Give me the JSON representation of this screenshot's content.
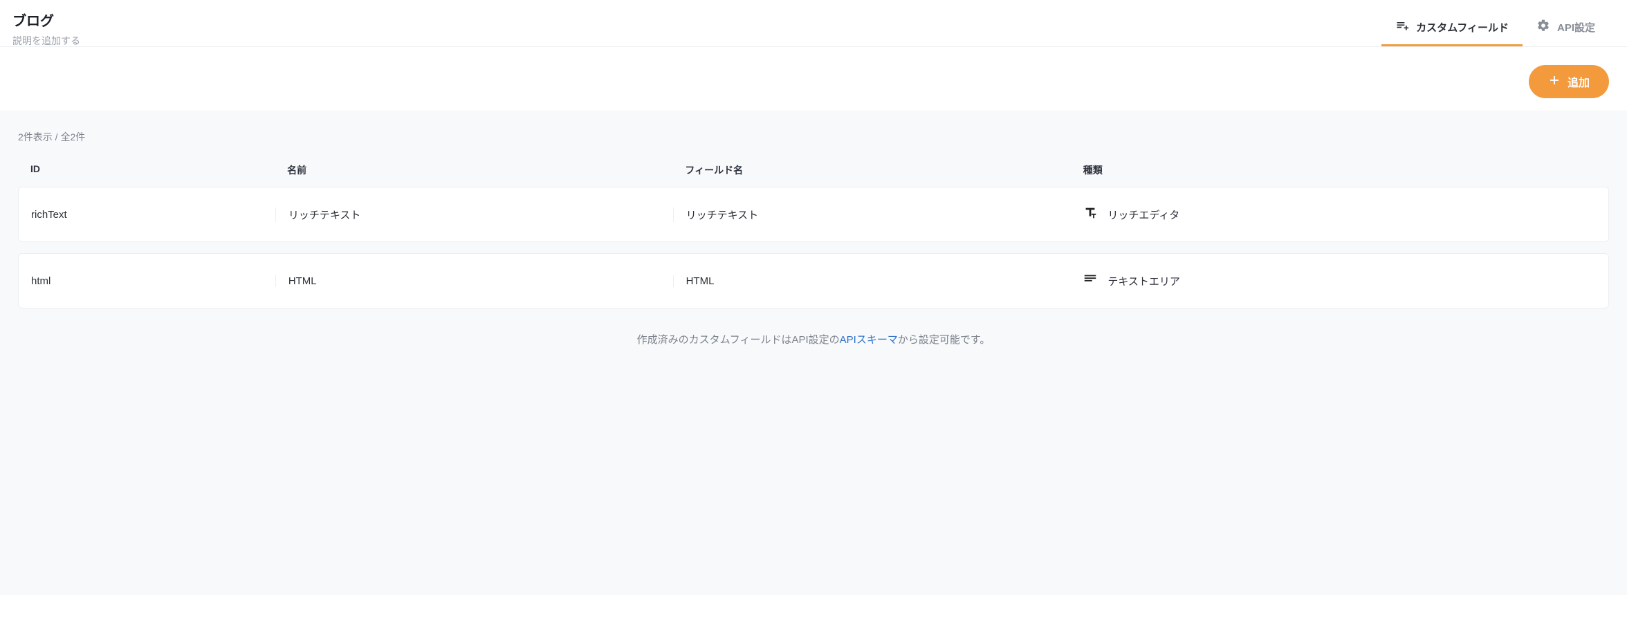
{
  "header": {
    "title": "ブログ",
    "subtitle": "説明を追加する",
    "tabs": {
      "custom_field": "カスタムフィールド",
      "api_settings": "API設定"
    }
  },
  "action": {
    "add": "追加"
  },
  "list": {
    "count": "2件表示 / 全2件",
    "columns": {
      "id": "ID",
      "name": "名前",
      "field_name": "フィールド名",
      "type": "種類"
    },
    "rows": [
      {
        "id": "richText",
        "name": "リッチテキスト",
        "field_name": "リッチテキスト",
        "type_label": "リッチエディタ",
        "type_icon": "rich"
      },
      {
        "id": "html",
        "name": "HTML",
        "field_name": "HTML",
        "type_label": "テキストエリア",
        "type_icon": "textarea"
      }
    ]
  },
  "footer": {
    "prefix": "作成済みのカスタムフィールドはAPI設定の",
    "link": "APIスキーマ",
    "suffix": "から設定可能です。"
  }
}
